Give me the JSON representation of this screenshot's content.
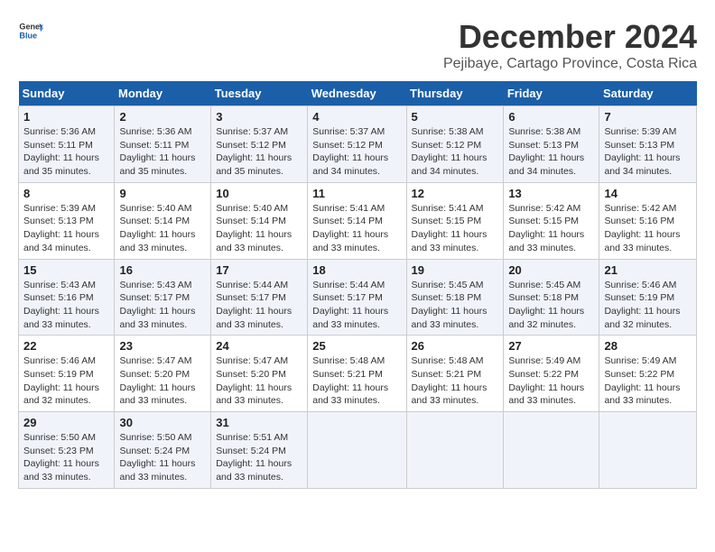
{
  "logo": {
    "line1": "General",
    "line2": "Blue"
  },
  "title": "December 2024",
  "subtitle": "Pejibaye, Cartago Province, Costa Rica",
  "weekdays": [
    "Sunday",
    "Monday",
    "Tuesday",
    "Wednesday",
    "Thursday",
    "Friday",
    "Saturday"
  ],
  "weeks": [
    [
      {
        "day": "1",
        "info": "Sunrise: 5:36 AM\nSunset: 5:11 PM\nDaylight: 11 hours\nand 35 minutes."
      },
      {
        "day": "2",
        "info": "Sunrise: 5:36 AM\nSunset: 5:11 PM\nDaylight: 11 hours\nand 35 minutes."
      },
      {
        "day": "3",
        "info": "Sunrise: 5:37 AM\nSunset: 5:12 PM\nDaylight: 11 hours\nand 35 minutes."
      },
      {
        "day": "4",
        "info": "Sunrise: 5:37 AM\nSunset: 5:12 PM\nDaylight: 11 hours\nand 34 minutes."
      },
      {
        "day": "5",
        "info": "Sunrise: 5:38 AM\nSunset: 5:12 PM\nDaylight: 11 hours\nand 34 minutes."
      },
      {
        "day": "6",
        "info": "Sunrise: 5:38 AM\nSunset: 5:13 PM\nDaylight: 11 hours\nand 34 minutes."
      },
      {
        "day": "7",
        "info": "Sunrise: 5:39 AM\nSunset: 5:13 PM\nDaylight: 11 hours\nand 34 minutes."
      }
    ],
    [
      {
        "day": "8",
        "info": "Sunrise: 5:39 AM\nSunset: 5:13 PM\nDaylight: 11 hours\nand 34 minutes."
      },
      {
        "day": "9",
        "info": "Sunrise: 5:40 AM\nSunset: 5:14 PM\nDaylight: 11 hours\nand 33 minutes."
      },
      {
        "day": "10",
        "info": "Sunrise: 5:40 AM\nSunset: 5:14 PM\nDaylight: 11 hours\nand 33 minutes."
      },
      {
        "day": "11",
        "info": "Sunrise: 5:41 AM\nSunset: 5:14 PM\nDaylight: 11 hours\nand 33 minutes."
      },
      {
        "day": "12",
        "info": "Sunrise: 5:41 AM\nSunset: 5:15 PM\nDaylight: 11 hours\nand 33 minutes."
      },
      {
        "day": "13",
        "info": "Sunrise: 5:42 AM\nSunset: 5:15 PM\nDaylight: 11 hours\nand 33 minutes."
      },
      {
        "day": "14",
        "info": "Sunrise: 5:42 AM\nSunset: 5:16 PM\nDaylight: 11 hours\nand 33 minutes."
      }
    ],
    [
      {
        "day": "15",
        "info": "Sunrise: 5:43 AM\nSunset: 5:16 PM\nDaylight: 11 hours\nand 33 minutes."
      },
      {
        "day": "16",
        "info": "Sunrise: 5:43 AM\nSunset: 5:17 PM\nDaylight: 11 hours\nand 33 minutes."
      },
      {
        "day": "17",
        "info": "Sunrise: 5:44 AM\nSunset: 5:17 PM\nDaylight: 11 hours\nand 33 minutes."
      },
      {
        "day": "18",
        "info": "Sunrise: 5:44 AM\nSunset: 5:17 PM\nDaylight: 11 hours\nand 33 minutes."
      },
      {
        "day": "19",
        "info": "Sunrise: 5:45 AM\nSunset: 5:18 PM\nDaylight: 11 hours\nand 33 minutes."
      },
      {
        "day": "20",
        "info": "Sunrise: 5:45 AM\nSunset: 5:18 PM\nDaylight: 11 hours\nand 32 minutes."
      },
      {
        "day": "21",
        "info": "Sunrise: 5:46 AM\nSunset: 5:19 PM\nDaylight: 11 hours\nand 32 minutes."
      }
    ],
    [
      {
        "day": "22",
        "info": "Sunrise: 5:46 AM\nSunset: 5:19 PM\nDaylight: 11 hours\nand 32 minutes."
      },
      {
        "day": "23",
        "info": "Sunrise: 5:47 AM\nSunset: 5:20 PM\nDaylight: 11 hours\nand 33 minutes."
      },
      {
        "day": "24",
        "info": "Sunrise: 5:47 AM\nSunset: 5:20 PM\nDaylight: 11 hours\nand 33 minutes."
      },
      {
        "day": "25",
        "info": "Sunrise: 5:48 AM\nSunset: 5:21 PM\nDaylight: 11 hours\nand 33 minutes."
      },
      {
        "day": "26",
        "info": "Sunrise: 5:48 AM\nSunset: 5:21 PM\nDaylight: 11 hours\nand 33 minutes."
      },
      {
        "day": "27",
        "info": "Sunrise: 5:49 AM\nSunset: 5:22 PM\nDaylight: 11 hours\nand 33 minutes."
      },
      {
        "day": "28",
        "info": "Sunrise: 5:49 AM\nSunset: 5:22 PM\nDaylight: 11 hours\nand 33 minutes."
      }
    ],
    [
      {
        "day": "29",
        "info": "Sunrise: 5:50 AM\nSunset: 5:23 PM\nDaylight: 11 hours\nand 33 minutes."
      },
      {
        "day": "30",
        "info": "Sunrise: 5:50 AM\nSunset: 5:24 PM\nDaylight: 11 hours\nand 33 minutes."
      },
      {
        "day": "31",
        "info": "Sunrise: 5:51 AM\nSunset: 5:24 PM\nDaylight: 11 hours\nand 33 minutes."
      },
      null,
      null,
      null,
      null
    ]
  ]
}
